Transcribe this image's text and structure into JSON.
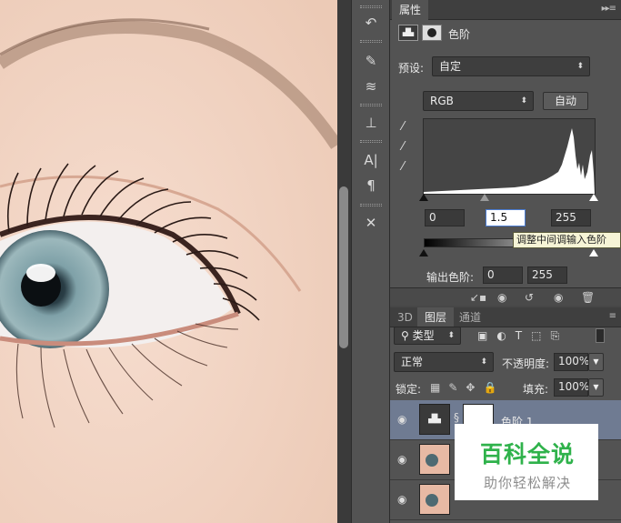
{
  "properties_panel": {
    "tab_label": "属性",
    "adjustment_title": "色阶",
    "preset_label": "预设:",
    "preset_value": "自定",
    "channel_value": "RGB",
    "auto_label": "自动",
    "input_black": "0",
    "input_gamma": "1.5",
    "input_white": "255",
    "tooltip": "调整中间调输入色阶",
    "output_label": "输出色阶:",
    "output_black": "0",
    "output_white": "255"
  },
  "layers_panel": {
    "tabs": [
      "3D",
      "图层",
      "通道"
    ],
    "filter_kind": "类型",
    "blend_mode": "正常",
    "opacity_label": "不透明度:",
    "opacity_value": "100%",
    "lock_label": "锁定:",
    "fill_label": "填充:",
    "fill_value": "100%",
    "layers": [
      {
        "name": "色阶 1",
        "selected": true
      },
      {
        "name": "",
        "selected": false
      },
      {
        "name": "",
        "selected": false
      }
    ]
  },
  "watermark": {
    "title": "百科全说",
    "subtitle": "助你轻松解决"
  },
  "colors": {
    "panel_bg": "#535353",
    "selected_layer": "#6f7b92",
    "watermark_green": "#2fb24b"
  },
  "icons": [
    "tool-history-icon",
    "tool-brush-presets-icon",
    "tool-brush-icon",
    "tool-clone-icon",
    "tool-character-icon",
    "tool-paragraph-icon",
    "tool-settings-icon"
  ]
}
